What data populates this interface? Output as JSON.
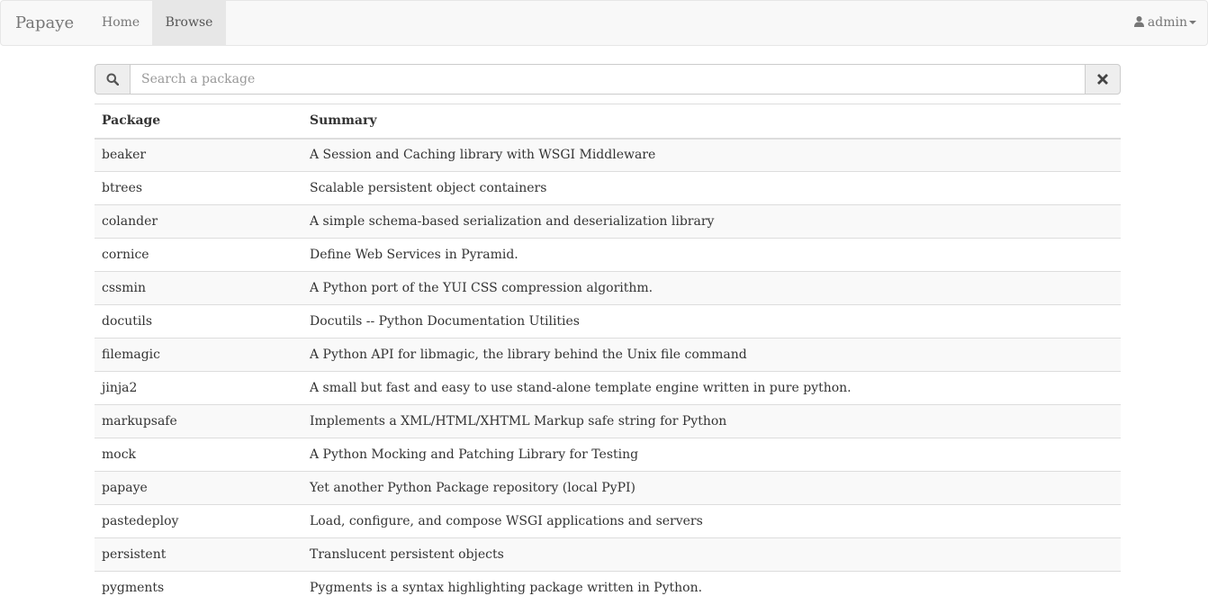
{
  "navbar": {
    "brand": "Papaye",
    "links": [
      {
        "label": "Home",
        "active": false
      },
      {
        "label": "Browse",
        "active": true
      }
    ],
    "user": {
      "label": "admin",
      "icon": "user-icon"
    }
  },
  "search": {
    "placeholder": "Search a package",
    "value": "",
    "icons": {
      "left": "search-icon",
      "right": "close-icon"
    }
  },
  "table": {
    "headers": {
      "package": "Package",
      "summary": "Summary"
    },
    "rows": [
      {
        "package": "beaker",
        "summary": "A Session and Caching library with WSGI Middleware"
      },
      {
        "package": "btrees",
        "summary": "Scalable persistent object containers"
      },
      {
        "package": "colander",
        "summary": "A simple schema-based serialization and deserialization library"
      },
      {
        "package": "cornice",
        "summary": "Define Web Services in Pyramid."
      },
      {
        "package": "cssmin",
        "summary": "A Python port of the YUI CSS compression algorithm."
      },
      {
        "package": "docutils",
        "summary": "Docutils -- Python Documentation Utilities"
      },
      {
        "package": "filemagic",
        "summary": "A Python API for libmagic, the library behind the Unix file command"
      },
      {
        "package": "jinja2",
        "summary": "A small but fast and easy to use stand-alone template engine written in pure python."
      },
      {
        "package": "markupsafe",
        "summary": "Implements a XML/HTML/XHTML Markup safe string for Python"
      },
      {
        "package": "mock",
        "summary": "A Python Mocking and Patching Library for Testing"
      },
      {
        "package": "papaye",
        "summary": "Yet another Python Package repository (local PyPI)"
      },
      {
        "package": "pastedeploy",
        "summary": "Load, configure, and compose WSGI applications and servers"
      },
      {
        "package": "persistent",
        "summary": "Translucent persistent objects"
      },
      {
        "package": "pygments",
        "summary": "Pygments is a syntax highlighting package written in Python."
      }
    ]
  },
  "colors": {
    "navbar_bg": "#f8f8f8",
    "active_nav_bg": "#e7e7e7",
    "stripe": "#f9f9f9",
    "border": "#dddddd"
  }
}
